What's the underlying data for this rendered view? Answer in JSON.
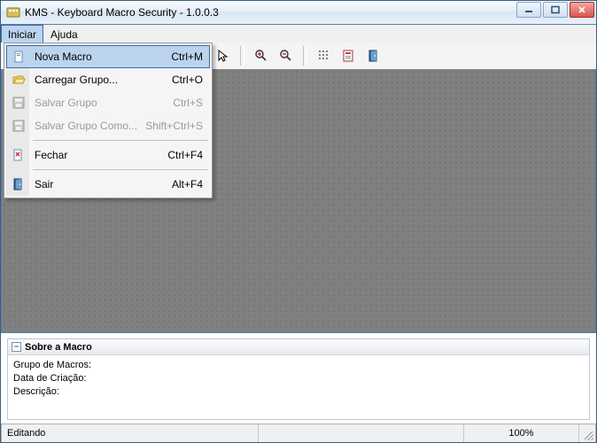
{
  "window": {
    "title": "KMS - Keyboard Macro Security - 1.0.0.3"
  },
  "menubar": {
    "items": [
      {
        "label": "Iniciar",
        "open": true
      },
      {
        "label": "Ajuda",
        "open": false
      }
    ]
  },
  "dropdown": {
    "items": [
      {
        "icon": "new-doc",
        "label": "Nova Macro",
        "shortcut": "Ctrl+M",
        "enabled": true,
        "highlight": true
      },
      {
        "icon": "folder-open",
        "label": "Carregar Grupo...",
        "shortcut": "Ctrl+O",
        "enabled": true,
        "highlight": false
      },
      {
        "icon": "save",
        "label": "Salvar Grupo",
        "shortcut": "Ctrl+S",
        "enabled": false,
        "highlight": false
      },
      {
        "icon": "save-as",
        "label": "Salvar Grupo Como...",
        "shortcut": "Shift+Ctrl+S",
        "enabled": false,
        "highlight": false
      },
      {
        "sep": true
      },
      {
        "icon": "close",
        "label": "Fechar",
        "shortcut": "Ctrl+F4",
        "enabled": true,
        "highlight": false
      },
      {
        "sep": true
      },
      {
        "icon": "exit",
        "label": "Sair",
        "shortcut": "Alt+F4",
        "enabled": true,
        "highlight": false
      }
    ]
  },
  "toolbar": {
    "buttons": [
      {
        "name": "pointer-tool",
        "icon": "pointer"
      },
      {
        "sep": true
      },
      {
        "name": "zoom-in-tool",
        "icon": "zoom-in"
      },
      {
        "name": "zoom-out-tool",
        "icon": "zoom-out"
      },
      {
        "sep": true
      },
      {
        "name": "grid-tool",
        "icon": "grid"
      },
      {
        "name": "macro-tool",
        "icon": "macro"
      },
      {
        "name": "door-tool",
        "icon": "door"
      }
    ]
  },
  "info": {
    "title": "Sobre a Macro",
    "lines": [
      "Grupo de Macros:",
      "Data de Criação:",
      "Descrição:"
    ]
  },
  "status": {
    "mode": "Editando",
    "zoom": "100%"
  }
}
